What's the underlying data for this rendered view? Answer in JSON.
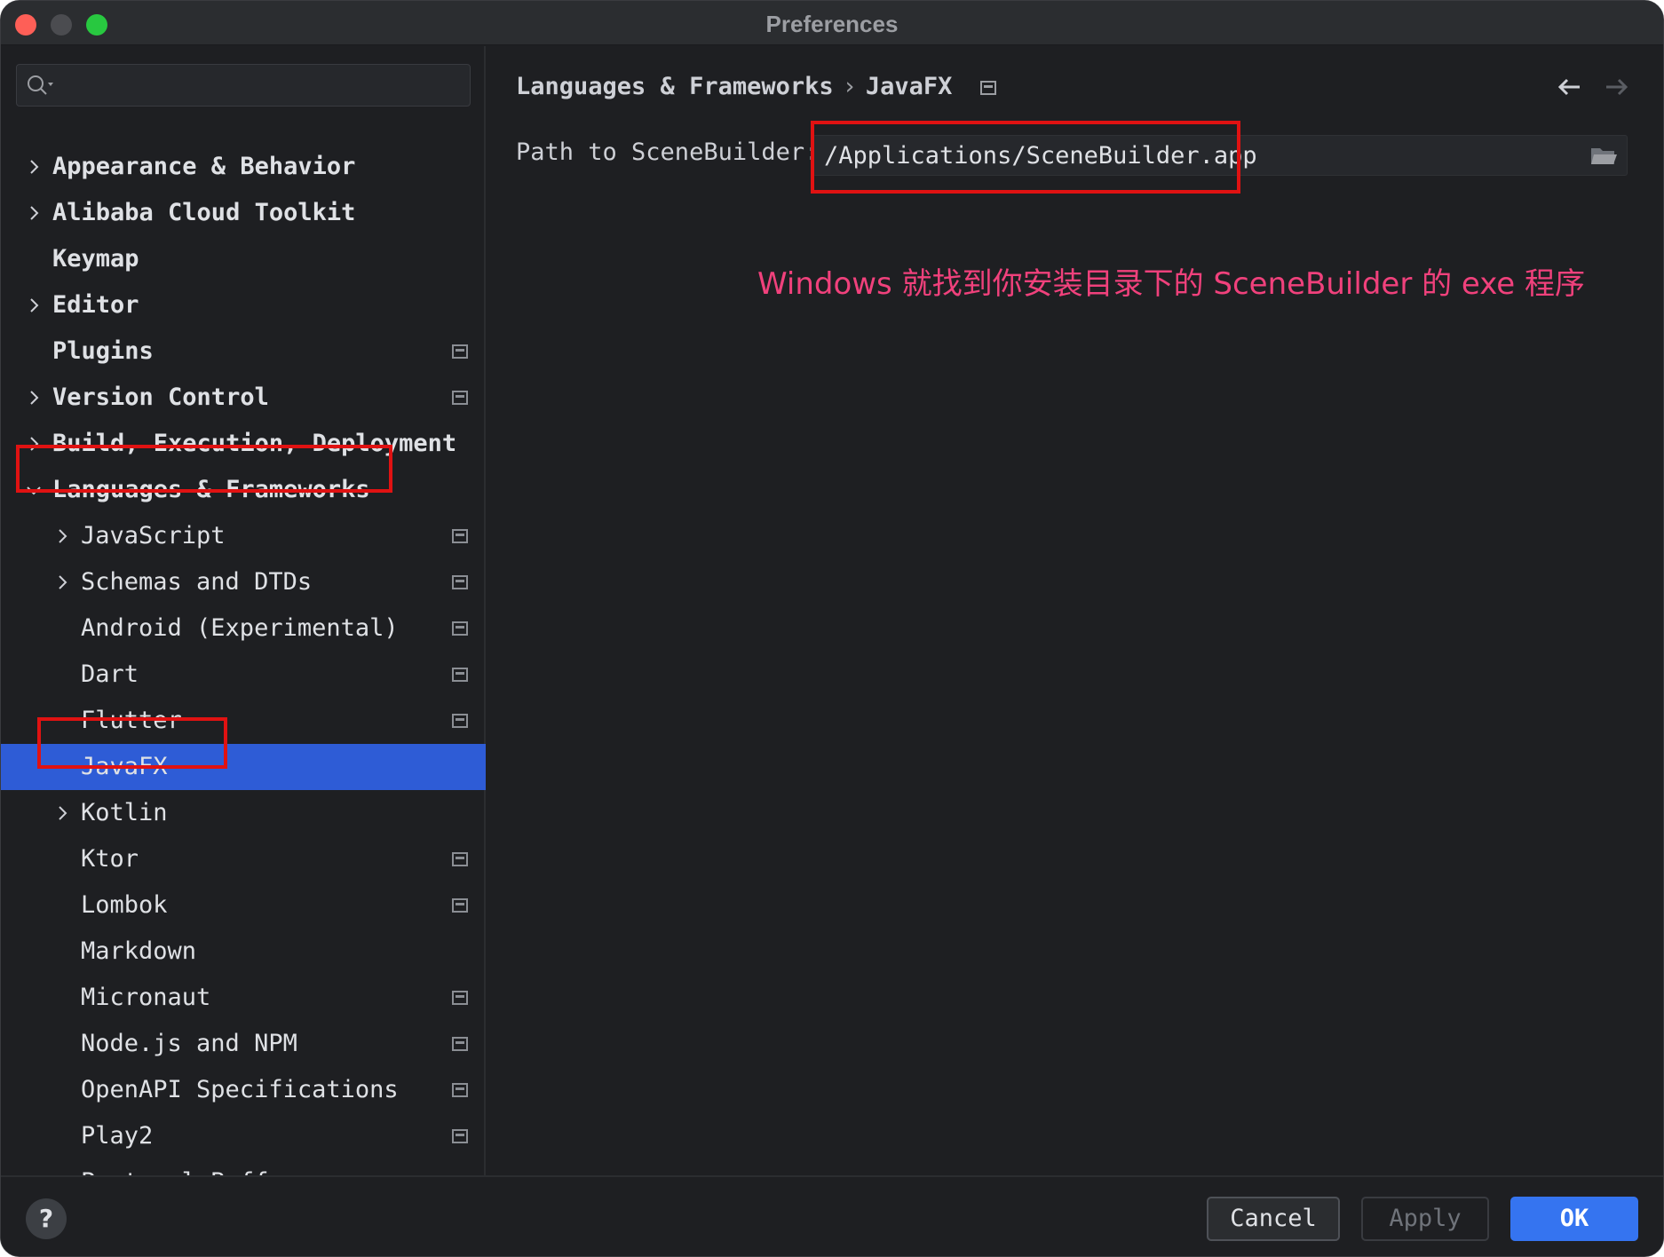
{
  "window": {
    "title": "Preferences"
  },
  "search": {
    "placeholder": ""
  },
  "sidebar": {
    "items": [
      {
        "label": "Appearance & Behavior",
        "level": 0,
        "chevron": "right",
        "bold": true,
        "project_icon": false,
        "selected": false
      },
      {
        "label": "Alibaba Cloud Toolkit",
        "level": 0,
        "chevron": "right",
        "bold": true,
        "project_icon": false,
        "selected": false
      },
      {
        "label": "Keymap",
        "level": 0,
        "chevron": "none",
        "bold": true,
        "project_icon": false,
        "selected": false
      },
      {
        "label": "Editor",
        "level": 0,
        "chevron": "right",
        "bold": true,
        "project_icon": false,
        "selected": false
      },
      {
        "label": "Plugins",
        "level": 0,
        "chevron": "none",
        "bold": true,
        "project_icon": true,
        "selected": false
      },
      {
        "label": "Version Control",
        "level": 0,
        "chevron": "right",
        "bold": true,
        "project_icon": true,
        "selected": false
      },
      {
        "label": "Build, Execution, Deployment",
        "level": 0,
        "chevron": "right",
        "bold": true,
        "project_icon": false,
        "selected": false
      },
      {
        "label": "Languages & Frameworks",
        "level": 0,
        "chevron": "down",
        "bold": true,
        "project_icon": false,
        "selected": false
      },
      {
        "label": "JavaScript",
        "level": 1,
        "chevron": "right",
        "bold": false,
        "project_icon": true,
        "selected": false
      },
      {
        "label": "Schemas and DTDs",
        "level": 1,
        "chevron": "right",
        "bold": false,
        "project_icon": true,
        "selected": false
      },
      {
        "label": "Android (Experimental)",
        "level": 1,
        "chevron": "none",
        "bold": false,
        "project_icon": true,
        "selected": false
      },
      {
        "label": "Dart",
        "level": 1,
        "chevron": "none",
        "bold": false,
        "project_icon": true,
        "selected": false
      },
      {
        "label": "Flutter",
        "level": 1,
        "chevron": "none",
        "bold": false,
        "project_icon": true,
        "selected": false
      },
      {
        "label": "JavaFX",
        "level": 1,
        "chevron": "none",
        "bold": false,
        "project_icon": false,
        "selected": true
      },
      {
        "label": "Kotlin",
        "level": 1,
        "chevron": "right",
        "bold": false,
        "project_icon": false,
        "selected": false
      },
      {
        "label": "Ktor",
        "level": 1,
        "chevron": "none",
        "bold": false,
        "project_icon": true,
        "selected": false
      },
      {
        "label": "Lombok",
        "level": 1,
        "chevron": "none",
        "bold": false,
        "project_icon": true,
        "selected": false
      },
      {
        "label": "Markdown",
        "level": 1,
        "chevron": "none",
        "bold": false,
        "project_icon": false,
        "selected": false
      },
      {
        "label": "Micronaut",
        "level": 1,
        "chevron": "none",
        "bold": false,
        "project_icon": true,
        "selected": false
      },
      {
        "label": "Node.js and NPM",
        "level": 1,
        "chevron": "none",
        "bold": false,
        "project_icon": true,
        "selected": false
      },
      {
        "label": "OpenAPI Specifications",
        "level": 1,
        "chevron": "none",
        "bold": false,
        "project_icon": true,
        "selected": false
      },
      {
        "label": "Play2",
        "level": 1,
        "chevron": "none",
        "bold": false,
        "project_icon": true,
        "selected": false
      },
      {
        "label": "Protocol Buffers",
        "level": 1,
        "chevron": "right",
        "bold": false,
        "project_icon": true,
        "selected": false
      }
    ]
  },
  "content": {
    "breadcrumb": [
      "Languages & Frameworks",
      "JavaFX"
    ],
    "breadcrumb_separator": "›",
    "path_label": "Path to SceneBuilder:",
    "path_value": "/Applications/SceneBuilder.app",
    "annotation": "Windows 就找到你安装目录下的 SceneBuilder 的 exe 程序"
  },
  "footer": {
    "help_label": "?",
    "cancel_label": "Cancel",
    "apply_label": "Apply",
    "ok_label": "OK"
  },
  "colors": {
    "background": "#1e1f22",
    "selection": "#2e5cd6",
    "highlight_box": "#e01212",
    "annotation": "#f0417c",
    "primary_button": "#3574f0"
  }
}
